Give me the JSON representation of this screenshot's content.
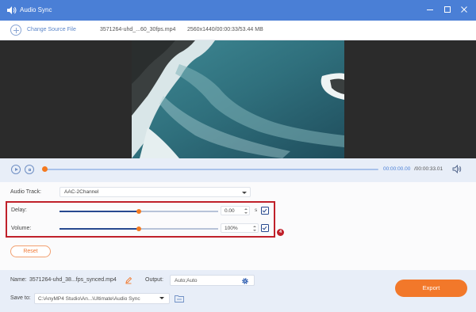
{
  "window": {
    "title": "Audio Sync",
    "icon": "audio-sync-icon",
    "controls": [
      "minimize-icon",
      "maximize-icon",
      "close-icon"
    ]
  },
  "toolbar": {
    "change_source_label": "Change Source File",
    "file_name": "3571264-uhd_...60_30fps.mp4",
    "file_info": "2560x1440/00:00:33/53.44 MB"
  },
  "playback": {
    "current_time": "00:00:00.00",
    "total_time": "/00:00:33.01",
    "progress_fraction": 0.0
  },
  "settings": {
    "audio_track_label": "Audio Track:",
    "audio_track_value": "AAC-2Channel",
    "delay_label": "Delay:",
    "delay_value": "0.00",
    "delay_unit": "s",
    "delay_slider_fraction": 0.5,
    "volume_label": "Volume:",
    "volume_value": "100%",
    "volume_slider_fraction": 0.5,
    "callout_number": "4",
    "reset_label": "Reset"
  },
  "footer": {
    "name_label": "Name:",
    "name_value": "3571264-uhd_38...fps_synced.mp4",
    "output_label": "Output:",
    "output_value": "Auto;Auto",
    "save_to_label": "Save to:",
    "save_to_value": "C:\\AnyMP4 Studio\\An...\\Ultimate\\Audio Sync",
    "export_label": "Export"
  },
  "colors": {
    "titlebar": "#4a7fd6",
    "accent_orange": "#f2782a",
    "highlight_red": "#c0202a",
    "slider_blue": "#27498f"
  }
}
